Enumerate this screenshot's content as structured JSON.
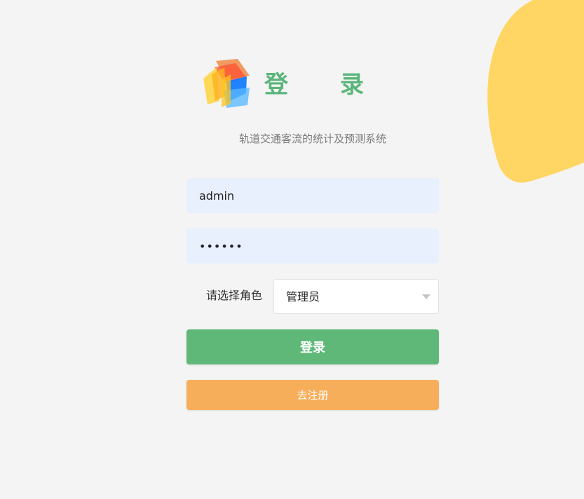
{
  "page": {
    "title_chars": [
      "登",
      "录"
    ],
    "subtitle": "轨道交通客流的统计及预测系统"
  },
  "form": {
    "username_value": "admin",
    "password_value": "••••••",
    "role_label": "请选择角色",
    "role_value": "管理员",
    "login_label": "登录",
    "register_label": "去注册"
  },
  "colors": {
    "background": "#f4f4f4",
    "title": "#5ab57a",
    "input_background": "#e8f0fe",
    "login_button": "#5fb878",
    "register_button": "#f7ae5a",
    "decorative_blob": "#ffd563"
  },
  "icons": {
    "logo": "cube-logo-icon",
    "dropdown": "chevron-down-icon"
  }
}
